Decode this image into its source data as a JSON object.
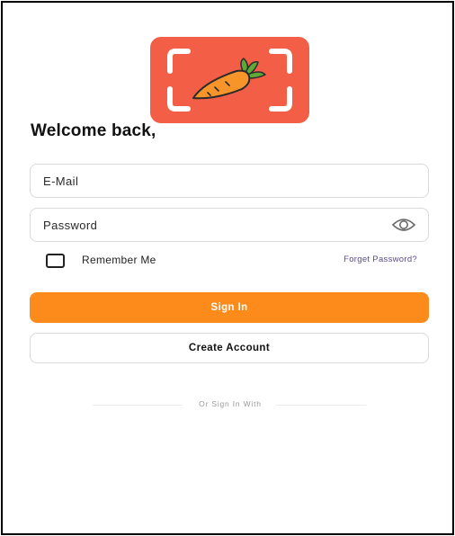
{
  "logo": {
    "icon": "carrot-scan-icon",
    "background": "#f25f46"
  },
  "header": {
    "welcome_text": "Welcome back,"
  },
  "form": {
    "email": {
      "placeholder": "E-Mail",
      "value": ""
    },
    "password": {
      "placeholder": "Password",
      "value": "",
      "toggle_icon": "eye-icon"
    },
    "remember_label": "Remember Me",
    "remember_checked": false,
    "forgot_link": "Forget Password?"
  },
  "actions": {
    "sign_in_label": "Sign In",
    "create_account_label": "Create Account",
    "sign_in_color": "#fc8b1c"
  },
  "social": {
    "divider_text": "Or Sign In With"
  }
}
